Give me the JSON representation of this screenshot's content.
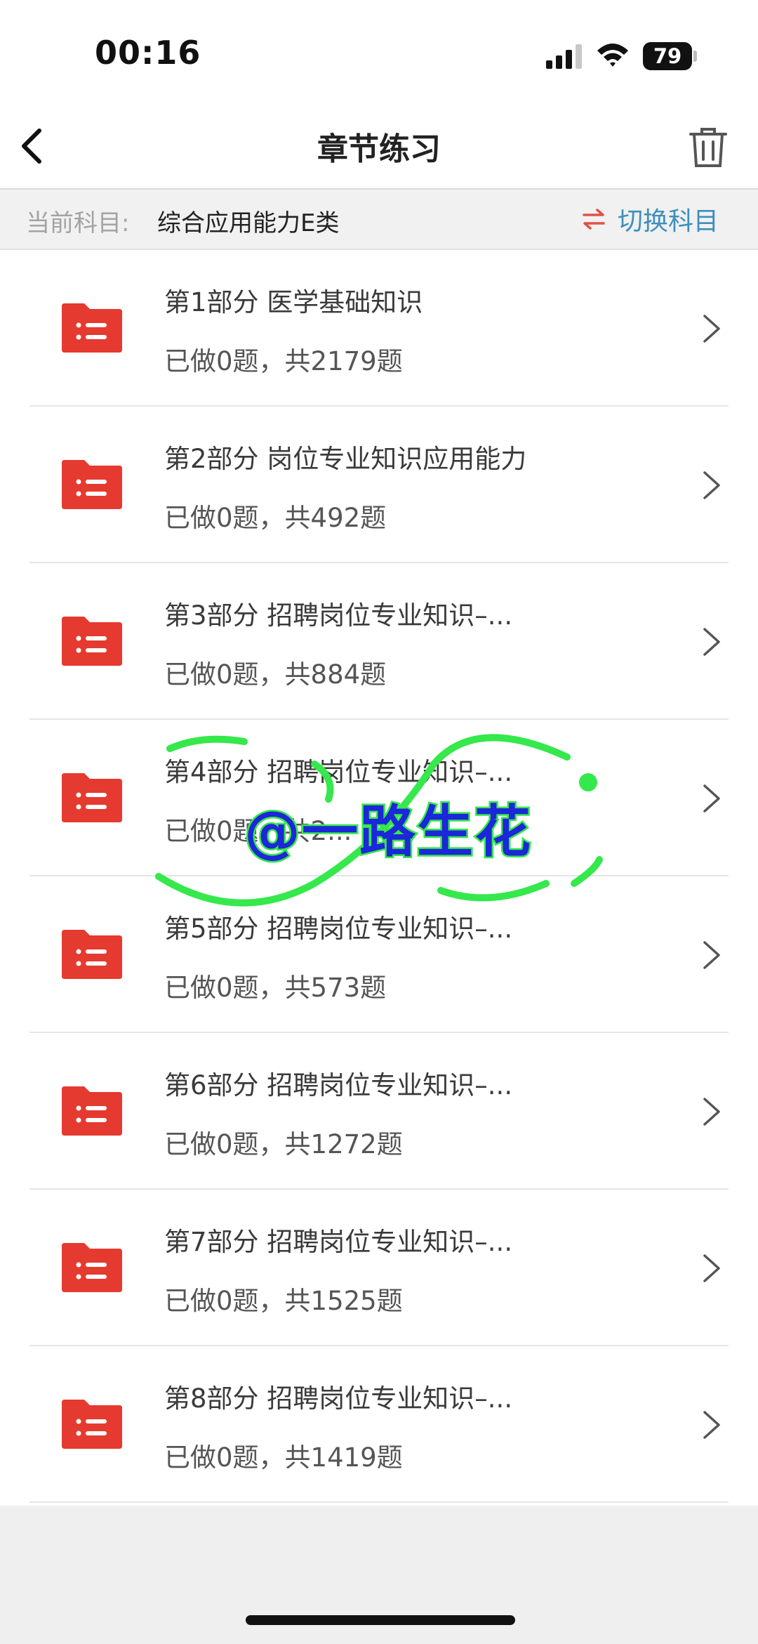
{
  "status_bar": {
    "time": "00:16",
    "battery": "79"
  },
  "nav": {
    "title": "章节练习",
    "back_icon": "chevron-left-icon",
    "trash_icon": "trash-icon"
  },
  "subject": {
    "label": "当前科目:",
    "name": "综合应用能力E类",
    "switch_label": "切换科目",
    "switch_icon": "swap-arrows-icon"
  },
  "chapters": [
    {
      "title": "第1部分  医学基础知识",
      "progress": "已做0题，共2179题"
    },
    {
      "title": "第2部分  岗位专业知识应用能力",
      "progress": "已做0题，共492题"
    },
    {
      "title": "第3部分  招聘岗位专业知识–...",
      "progress": "已做0题，共884题"
    },
    {
      "title": "第4部分  招聘岗位专业知识–...",
      "progress": "已做0题，共2..."
    },
    {
      "title": "第5部分  招聘岗位专业知识–...",
      "progress": "已做0题，共573题"
    },
    {
      "title": "第6部分  招聘岗位专业知识–...",
      "progress": "已做0题，共1272题"
    },
    {
      "title": "第7部分  招聘岗位专业知识–...",
      "progress": "已做0题，共1525题"
    },
    {
      "title": "第8部分  招聘岗位专业知识–...",
      "progress": "已做0题，共1419题"
    }
  ],
  "watermark": {
    "text": "@一路生花"
  },
  "colors": {
    "folder": "#e53a2f",
    "switch_text": "#3d8fbd",
    "switch_icon": "#e05345",
    "watermark_text": "#1b27d9",
    "watermark_outline": "#35e84b"
  }
}
